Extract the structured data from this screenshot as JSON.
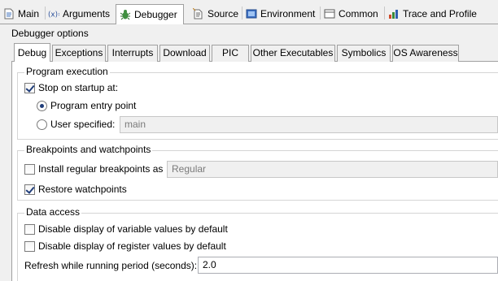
{
  "top_tabs": [
    {
      "label": "Main",
      "icon": "main-icon"
    },
    {
      "label": "Arguments",
      "icon": "arguments-icon"
    },
    {
      "label": "Debugger",
      "icon": "debugger-icon",
      "active": true
    },
    {
      "label": "Source",
      "icon": "source-icon"
    },
    {
      "label": "Environment",
      "icon": "environment-icon"
    },
    {
      "label": "Common",
      "icon": "common-icon"
    },
    {
      "label": "Trace and Profile",
      "icon": "trace-profile-icon"
    }
  ],
  "debugger_options": {
    "legend": "Debugger options",
    "tabs": [
      "Debug",
      "Exceptions",
      "Interrupts",
      "Download",
      "PIC",
      "Other Executables",
      "Symbolics",
      "OS Awareness"
    ],
    "active_tab": "Debug"
  },
  "program_execution": {
    "title": "Program execution",
    "stop_on_startup_label": "Stop on startup at:",
    "stop_on_startup_checked": true,
    "entry_point_label": "Program entry point",
    "entry_point_selected": true,
    "user_specified_label": "User specified:",
    "user_specified_value": "main"
  },
  "breakpoints": {
    "title": "Breakpoints and watchpoints",
    "install_label": "Install regular breakpoints as",
    "install_checked": false,
    "install_value": "Regular",
    "restore_label": "Restore watchpoints",
    "restore_checked": true
  },
  "data_access": {
    "title": "Data access",
    "disable_variable_label": "Disable display of variable values by default",
    "disable_variable_checked": false,
    "disable_register_label": "Disable display of register values by default",
    "disable_register_checked": false,
    "refresh_label": "Refresh while running period (seconds):",
    "refresh_value": "2.0"
  }
}
